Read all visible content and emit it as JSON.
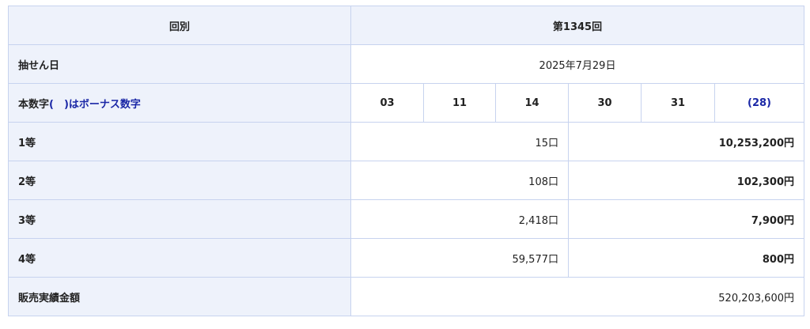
{
  "header": {
    "label": "回別",
    "value": "第1345回"
  },
  "draw_date": {
    "label": "抽せん日",
    "value": "2025年7月29日"
  },
  "numbers": {
    "label_main": "本数字",
    "label_paren": "(　)はボーナス数字",
    "main": [
      "03",
      "11",
      "14",
      "30",
      "31"
    ],
    "bonus": "(28)"
  },
  "prizes": [
    {
      "rank": "1等",
      "winners": "15口",
      "amount": "10,253,200円"
    },
    {
      "rank": "2等",
      "winners": "108口",
      "amount": "102,300円"
    },
    {
      "rank": "3等",
      "winners": "2,418口",
      "amount": "7,900円"
    },
    {
      "rank": "4等",
      "winners": "59,577口",
      "amount": "800円"
    }
  ],
  "sales": {
    "label": "販売実績金額",
    "value": "520,203,600円"
  },
  "colors": {
    "header_bg": "#eef2fb",
    "border": "#c7d3ef",
    "bonus_text": "#1a27a6"
  }
}
